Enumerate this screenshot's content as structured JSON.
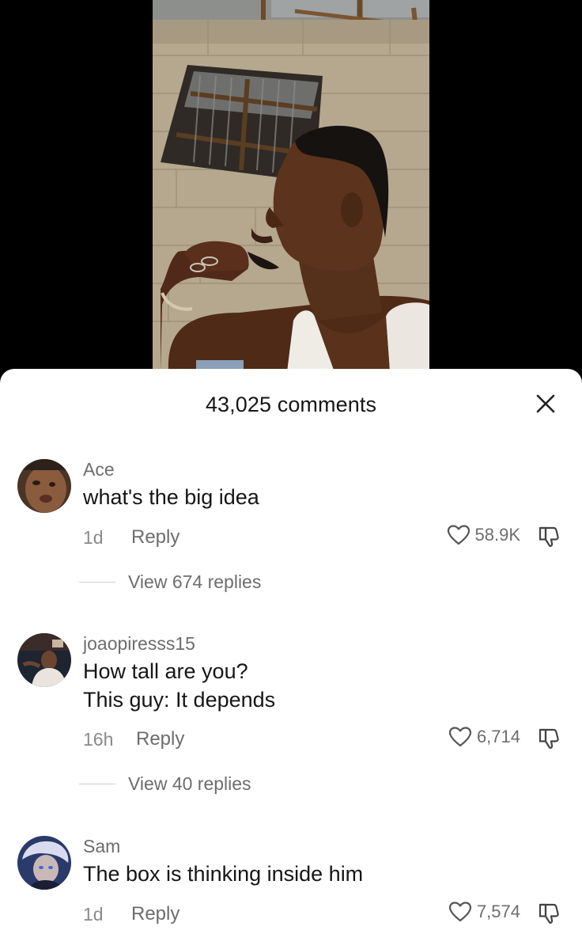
{
  "sheet": {
    "title": "43,025 comments"
  },
  "comments": [
    {
      "username": "Ace",
      "lines": [
        "what's the big idea"
      ],
      "time": "1d",
      "reply_label": "Reply",
      "likes": "58.9K",
      "view_replies": "View 674 replies"
    },
    {
      "username": "joaopiresss15",
      "lines": [
        "How tall are you?",
        "This guy: It depends"
      ],
      "time": "16h",
      "reply_label": "Reply",
      "likes": "6,714",
      "view_replies": "View 40 replies"
    },
    {
      "username": "Sam",
      "lines": [
        "The box is thinking inside him"
      ],
      "time": "1d",
      "reply_label": "Reply",
      "likes": "7,574"
    }
  ],
  "icons": {
    "close": "close-icon",
    "like": "heart-outline-icon",
    "dislike": "thumbs-down-icon"
  }
}
